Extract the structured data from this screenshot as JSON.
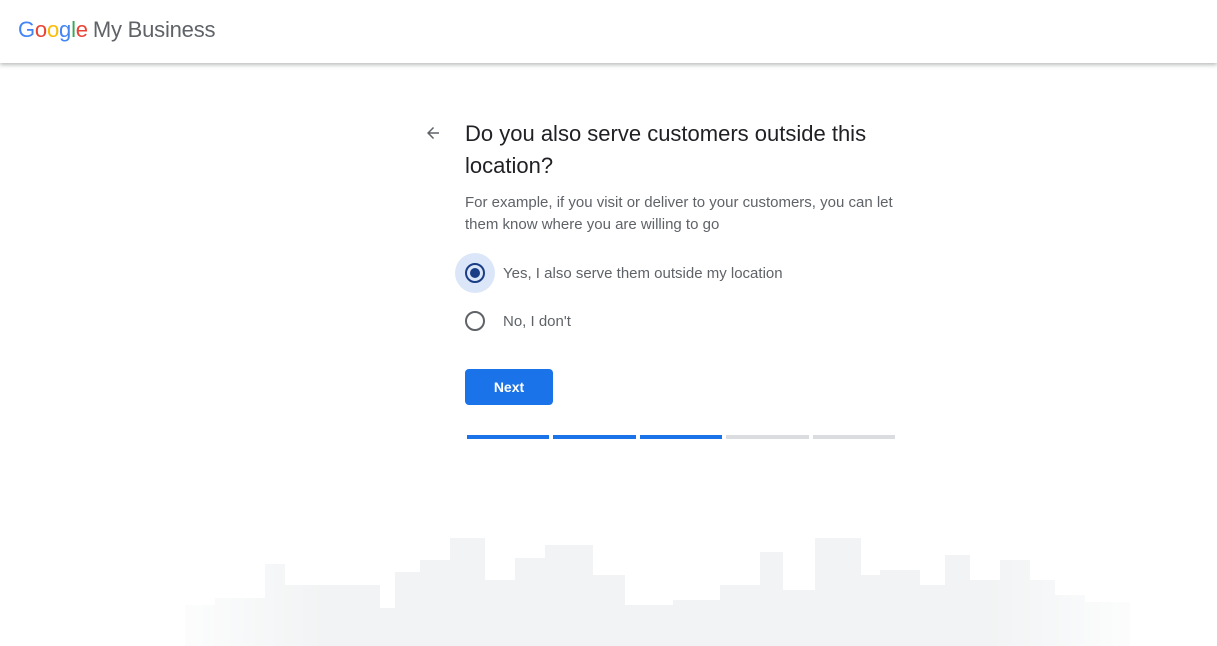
{
  "header": {
    "logo_letters": [
      "G",
      "o",
      "o",
      "g",
      "l",
      "e"
    ],
    "product_name": "My Business"
  },
  "page": {
    "title": "Do you also serve customers outside this location?",
    "subtitle": "For example, if you visit or deliver to your customers, you can let them know where you are willing to go",
    "back_icon": "arrow-back-icon",
    "options": [
      {
        "label": "Yes, I also serve them outside my location",
        "selected": true
      },
      {
        "label": "No, I don't",
        "selected": false
      }
    ],
    "next_label": "Next",
    "progress": {
      "total_steps": 5,
      "completed_steps": 3
    }
  },
  "colors": {
    "primary": "#1a73e8",
    "radio_checked": "#1a3d85",
    "radio_highlight": "#dbe7f8",
    "text_primary": "#202124",
    "text_secondary": "#5f6368",
    "progress_inactive": "#dadce0",
    "skyline": "#f1f3f4"
  }
}
